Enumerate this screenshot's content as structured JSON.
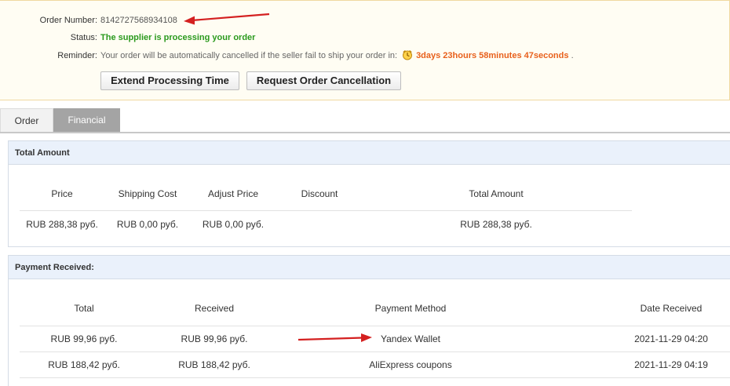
{
  "order_info": {
    "order_number_label": "Order Number:",
    "order_number": "8142727568934108",
    "status_label": "Status:",
    "status_value": "The supplier is processing your order",
    "reminder_label": "Reminder:",
    "reminder_text": "Your order will be automatically cancelled if the seller fail to ship your order in:",
    "countdown": "3days 23hours 58minutes 47seconds",
    "countdown_suffix": ".",
    "clock_icon": "alarm-clock-icon",
    "colors": {
      "status": "#2b9a1e",
      "countdown": "#e8601c",
      "annotation_arrow": "#d42020"
    }
  },
  "actions": {
    "extend_label": "Extend Processing Time",
    "cancel_label": "Request Order Cancellation"
  },
  "tabs": [
    {
      "label": "Order",
      "active": false
    },
    {
      "label": "Financial",
      "active": true
    }
  ],
  "total_amount": {
    "title": "Total Amount",
    "columns": [
      "Price",
      "Shipping Cost",
      "Adjust Price",
      "Discount",
      "Total Amount"
    ],
    "row": [
      "RUB 288,38 руб.",
      "RUB 0,00 руб.",
      "RUB 0,00 руб.",
      "",
      "RUB 288,38 руб."
    ]
  },
  "payment_received": {
    "title": "Payment Received:",
    "columns": [
      "Total",
      "Received",
      "Payment Method",
      "Date Received"
    ],
    "rows": [
      [
        "RUB 99,96 руб.",
        "RUB 99,96 руб.",
        "Yandex Wallet",
        "2021-11-29 04:20"
      ],
      [
        "RUB 188,42 руб.",
        "RUB 188,42 руб.",
        "AliExpress coupons",
        "2021-11-29 04:19"
      ]
    ]
  }
}
